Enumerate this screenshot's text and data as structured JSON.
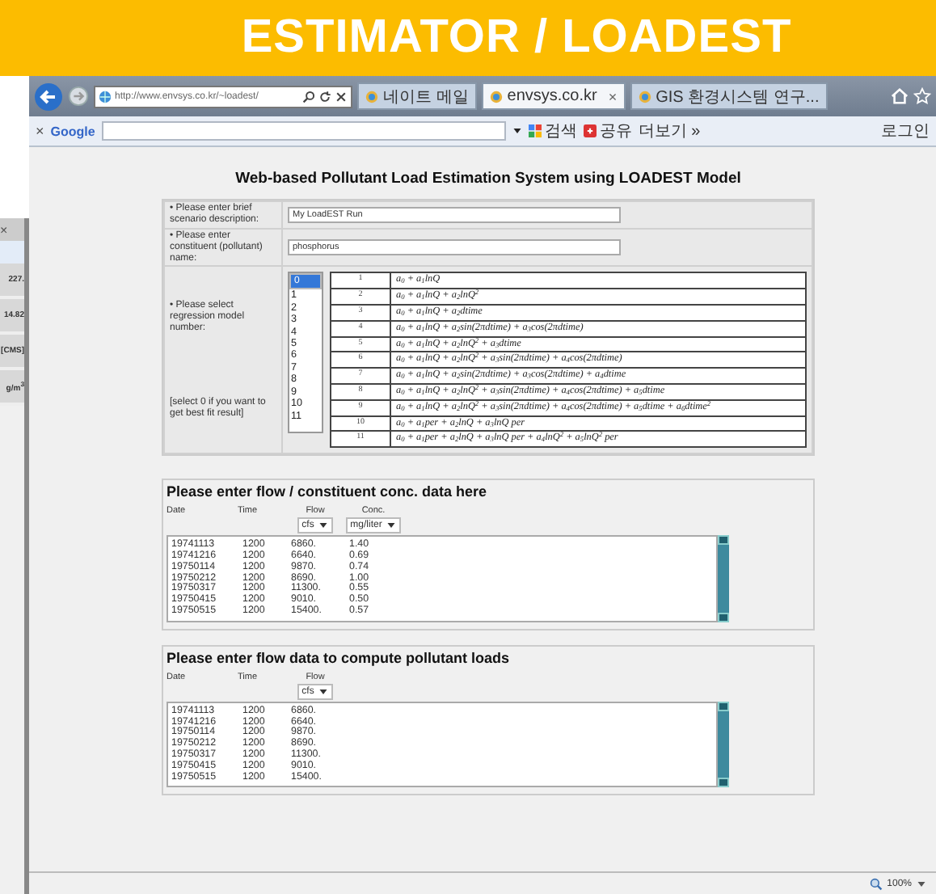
{
  "slide_title": "ESTIMATOR / LOADEST",
  "background_window": {
    "tab_close": "×",
    "texts": [
      "227.",
      "14.82",
      "[CMS]",
      "g/m$^{3}$"
    ]
  },
  "browser": {
    "address": "http://www.envsys.co.kr/~loadest/",
    "tabs": [
      {
        "label": "네이트 메일",
        "selected": false
      },
      {
        "label": "envsys.co.kr",
        "selected": true
      },
      {
        "label": "GIS 환경시스템 연구...",
        "selected": false
      }
    ],
    "tab_close": "×"
  },
  "google_bar": {
    "close": "×",
    "logo": "Google",
    "search": "검색",
    "share": "공유",
    "more": "더보기 »",
    "login": "로그인"
  },
  "page": {
    "title": "Web-based Pollutant Load Estimation System using LOADEST Model",
    "fields": [
      {
        "label": "• Please enter brief scenario description:",
        "value": "My LoadEST Run"
      },
      {
        "label": "• Please enter constituent (pollutant) name:",
        "value": "phosphorus"
      }
    ],
    "model": {
      "label": "• Please select regression model number:",
      "hint": "[select 0 if you want to get best fit result]",
      "options": [
        {
          "label": "0",
          "selected": true
        },
        {
          "label": "1",
          "selected": false
        },
        {
          "label": "2",
          "selected": false
        },
        {
          "label": "3",
          "selected": false
        },
        {
          "label": "4",
          "selected": false
        },
        {
          "label": "5",
          "selected": false
        },
        {
          "label": "6",
          "selected": false
        },
        {
          "label": "7",
          "selected": false
        },
        {
          "label": "8",
          "selected": false
        },
        {
          "label": "9",
          "selected": false
        },
        {
          "label": "10",
          "selected": false
        },
        {
          "label": "11",
          "selected": false
        }
      ],
      "formulas": [
        {
          "number": "1",
          "formula": "a$_{0}$ + a$_{1}$lnQ"
        },
        {
          "number": "2",
          "formula": "a$_{0}$ + a$_{1}$lnQ + a$_{2}$lnQ$^{2}$"
        },
        {
          "number": "3",
          "formula": "a$_{0}$ + a$_{1}$lnQ + a$_{2}$dtime"
        },
        {
          "number": "4",
          "formula": "a$_{0}$ + a$_{1}$lnQ + a$_{2}$sin(2πdtime) + a$_{3}$cos(2πdtime)"
        },
        {
          "number": "5",
          "formula": "a$_{0}$ + a$_{1}$lnQ + a$_{2}$lnQ$^{2}$ + a$_{3}$dtime"
        },
        {
          "number": "6",
          "formula": "a$_{0}$ + a$_{1}$lnQ + a$_{2}$lnQ$^{2}$ + a$_{3}$sin(2πdtime) + a$_{4}$cos(2πdtime)"
        },
        {
          "number": "7",
          "formula": "a$_{0}$ + a$_{1}$lnQ + a$_{2}$sin(2πdtime) + a$_{3}$cos(2πdtime) + a$_{4}$dtime"
        },
        {
          "number": "8",
          "formula": "a$_{0}$ + a$_{1}$lnQ + a$_{2}$lnQ$^{2}$ + a$_{3}$sin(2πdtime) + a$_{4}$cos(2πdtime) + a$_{5}$dtime"
        },
        {
          "number": "9",
          "formula": "a$_{0}$ + a$_{1}$lnQ + a$_{2}$lnQ$^{2}$ + a$_{3}$sin(2πdtime) + a$_{4}$cos(2πdtime) + a$_{5}$dtime + a$_{6}$dtime$^{2}$"
        },
        {
          "number": "10",
          "formula": "a$_{0}$ + a$_{1}$per + a$_{2}$lnQ + a$_{3}$lnQ per"
        },
        {
          "number": "11",
          "formula": "a$_{0}$ + a$_{1}$per + a$_{2}$lnQ + a$_{3}$lnQ per + a$_{4}$lnQ$^{2}$ + a$_{5}$lnQ$^{2}$ per"
        }
      ]
    },
    "sections": [
      {
        "title": "Please enter flow / constituent conc. data here",
        "columns": [
          {
            "label": "Date"
          },
          {
            "label": "Time"
          },
          {
            "label": "Flow",
            "unit": "cfs"
          },
          {
            "label": "Conc.",
            "unit": "mg/liter"
          }
        ],
        "rows": [
          [
            "19741113",
            "1200",
            "6860.",
            "1.40"
          ],
          [
            "19741216",
            "1200",
            "6640.",
            "0.69"
          ],
          [
            "19750114",
            "1200",
            "9870.",
            "0.74"
          ],
          [
            "19750212",
            "1200",
            "8690.",
            "1.00"
          ],
          [
            "19750317",
            "1200",
            "11300.",
            "0.55"
          ],
          [
            "19750415",
            "1200",
            "9010.",
            "0.50"
          ],
          [
            "19750515",
            "1200",
            "15400.",
            "0.57"
          ]
        ]
      },
      {
        "title": "Please enter flow data to compute pollutant loads",
        "columns": [
          {
            "label": "Date"
          },
          {
            "label": "Time"
          },
          {
            "label": "Flow",
            "unit": "cfs"
          }
        ],
        "rows": [
          [
            "19741113",
            "1200",
            "6860."
          ],
          [
            "19741216",
            "1200",
            "6640."
          ],
          [
            "19750114",
            "1200",
            "9870."
          ],
          [
            "19750212",
            "1200",
            "8690."
          ],
          [
            "19750317",
            "1200",
            "11300."
          ],
          [
            "19750415",
            "1200",
            "9010."
          ],
          [
            "19750515",
            "1200",
            "15400."
          ]
        ]
      }
    ]
  },
  "status_bar": {
    "zoom": "100%"
  }
}
